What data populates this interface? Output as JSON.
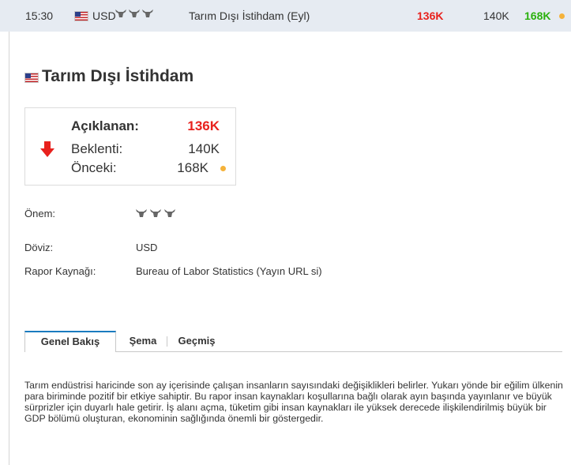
{
  "event_row": {
    "time": "15:30",
    "currency": "USD",
    "importance_icons": [
      "bull-icon",
      "bull-icon",
      "bull-icon"
    ],
    "name": "Tarım Dışı İstihdam (Eyl)",
    "actual": "136K",
    "forecast": "140K",
    "previous": "168K"
  },
  "title": "Tarım Dışı İstihdam",
  "summary": {
    "actual_label": "Açıklanan:",
    "actual_value": "136K",
    "forecast_label": "Beklenti:",
    "forecast_value": "140K",
    "previous_label": "Önceki:",
    "previous_value": "168K"
  },
  "details": {
    "importance_label": "Önem:",
    "currency_label": "Döviz:",
    "currency_value": "USD",
    "source_label": "Rapor Kaynağı:",
    "source_value": "Bureau of Labor Statistics (Yayın URL si)"
  },
  "tabs": [
    "Genel Bakış",
    "Şema",
    "Geçmiş"
  ],
  "overview_text": "Tarım endüstrisi haricinde son ay içerisinde çalışan insanların sayısındaki değişiklikleri belirler. Yukarı yönde bir eğilim ülkenin para biriminde pozitif bir etkiye sahiptir. Bu rapor insan kaynakları koşullarına bağlı olarak ayın başında yayınlanır ve büyük sürprizler için duyarlı hale getirir. İş alanı açma, tüketim gibi insan kaynakları ile yüksek derecede ilişkilendirilmiş büyük bir GDP bölümü oluşturan, ekonominin sağlığında önemli bir göstergedir.",
  "colors": {
    "actual": "#e8211d",
    "previous_better": "#2bb10e",
    "dot": "#f5b23a",
    "row_bg": "#e6ebf2",
    "tab_accent": "#1a7bbf"
  }
}
